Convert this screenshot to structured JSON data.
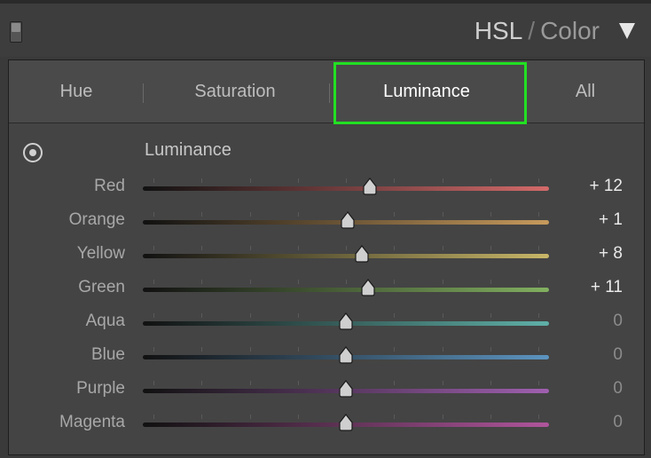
{
  "header": {
    "title_main": "HSL",
    "title_sep": "/",
    "title_secondary": "Color",
    "collapse_icon": "triangle-down-icon"
  },
  "tabs": [
    {
      "label": "Hue",
      "active": false
    },
    {
      "label": "Saturation",
      "active": false
    },
    {
      "label": "Luminance",
      "active": true
    },
    {
      "label": "All",
      "active": false
    }
  ],
  "section": {
    "title": "Luminance",
    "icon": "target-adjust-icon"
  },
  "slider_range": [
    -100,
    100
  ],
  "colors": {
    "highlight": "#22e022"
  },
  "sliders": [
    {
      "label": "Red",
      "value": 12,
      "display": "+ 12",
      "color": "#d46a6a"
    },
    {
      "label": "Orange",
      "value": 1,
      "display": "+ 1",
      "color": "#c79a5c"
    },
    {
      "label": "Yellow",
      "value": 8,
      "display": "+ 8",
      "color": "#c8b768"
    },
    {
      "label": "Green",
      "value": 11,
      "display": "+ 11",
      "color": "#82b060"
    },
    {
      "label": "Aqua",
      "value": 0,
      "display": "0",
      "color": "#5fb0a8"
    },
    {
      "label": "Blue",
      "value": 0,
      "display": "0",
      "color": "#5c94c0"
    },
    {
      "label": "Purple",
      "value": 0,
      "display": "0",
      "color": "#a060b0"
    },
    {
      "label": "Magenta",
      "value": 0,
      "display": "0",
      "color": "#b0559c"
    }
  ]
}
